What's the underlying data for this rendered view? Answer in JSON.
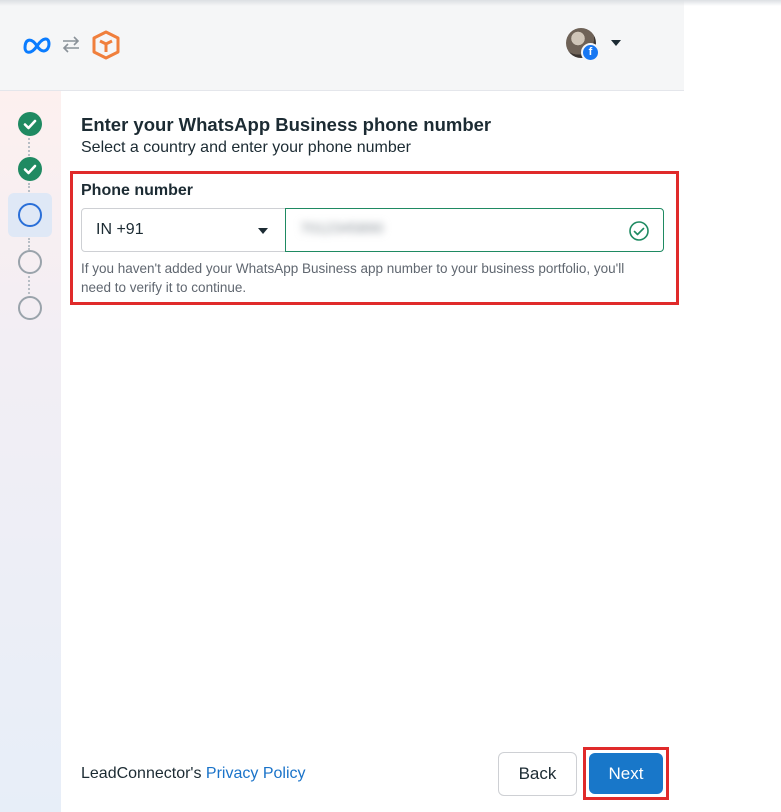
{
  "header": {
    "logos": [
      "meta-logo",
      "swap-icon",
      "leadconnector-logo"
    ],
    "account_badge": "f"
  },
  "stepper": {
    "steps": [
      "done",
      "done",
      "current",
      "todo",
      "todo"
    ]
  },
  "main": {
    "title": "Enter your WhatsApp Business phone number",
    "subtitle": "Select a country and enter your phone number",
    "phone_label": "Phone number",
    "country_value": "IN +91",
    "phone_value": "7012345890",
    "helper": "If you haven't added your WhatsApp Business app number to your business portfolio, you'll need to verify it to continue."
  },
  "footer": {
    "owner_text": "LeadConnector's",
    "privacy_link": "Privacy Policy",
    "back_label": "Back",
    "next_label": "Next"
  },
  "colors": {
    "accent": "#1877c9",
    "success": "#1f8a62",
    "highlight": "#e02a2a",
    "current_step": "#2a6fd8"
  }
}
